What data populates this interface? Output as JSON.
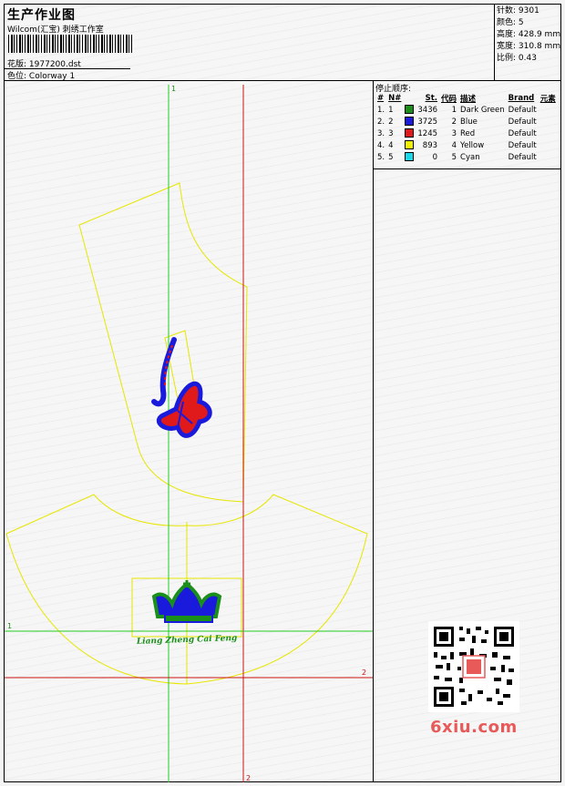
{
  "header": {
    "title": "生产作业图",
    "company": "Wilcom(汇宝) 刺绣工作室",
    "design_label": "花版:",
    "design_value": "1977200.dst",
    "colorway_label": "色位:",
    "colorway_value": "Colorway 1"
  },
  "stats": [
    {
      "label": "针数",
      "value": "9301"
    },
    {
      "label": "颜色",
      "value": "5"
    },
    {
      "label": "高度",
      "value": "428.9 mm"
    },
    {
      "label": "宽度",
      "value": "310.8 mm"
    },
    {
      "label": "比例",
      "value": "0.43"
    }
  ],
  "stop_sequence": {
    "title": "停止顺序:",
    "columns": [
      "#",
      "N#",
      "St.",
      "代码",
      "描述",
      "Brand",
      "元素"
    ],
    "rows": [
      {
        "num": "1.",
        "n": "1",
        "color": "#1a8f1a",
        "st": "3436",
        "code": "1",
        "desc": "Dark Green",
        "brand": "Default"
      },
      {
        "num": "2.",
        "n": "2",
        "color": "#1a1adc",
        "st": "3725",
        "code": "2",
        "desc": "Blue",
        "brand": "Default"
      },
      {
        "num": "3.",
        "n": "3",
        "color": "#e01a1a",
        "st": "1245",
        "code": "3",
        "desc": "Red",
        "brand": "Default"
      },
      {
        "num": "4.",
        "n": "4",
        "color": "#f0f000",
        "st": "893",
        "code": "4",
        "desc": "Yellow",
        "brand": "Default"
      },
      {
        "num": "5.",
        "n": "5",
        "color": "#1ad8e8",
        "st": "0",
        "code": "5",
        "desc": "Cyan",
        "brand": "Default"
      }
    ]
  },
  "axes": {
    "green_v": "1",
    "green_h": "1",
    "red_h": "2",
    "red_v": "2"
  },
  "crown_text": "Liang Zheng Cai Feng",
  "watermark": "6xiu.com",
  "colors": {
    "outline": "#e6e600",
    "green": "#1a8f1a",
    "blue": "#1a1adc",
    "red": "#e01a1a",
    "axis_green": "#22cc22",
    "axis_red": "#cc1111"
  }
}
